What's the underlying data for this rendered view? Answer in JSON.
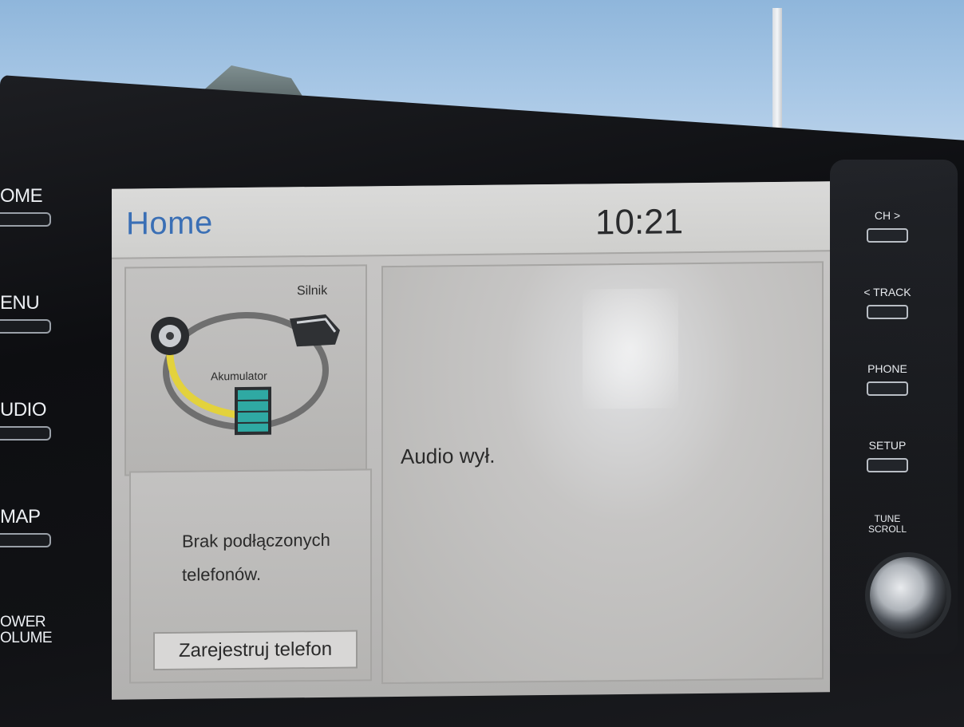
{
  "screen": {
    "title": "Home",
    "clock": "10:21"
  },
  "energy_monitor": {
    "engine_label": "Silnik",
    "battery_label": "Akumulator"
  },
  "phone_tile": {
    "message_line1": "Brak podłączonych",
    "message_line2": "telefonów.",
    "register_button": "Zarejestruj telefon"
  },
  "audio_tile": {
    "status": "Audio wył."
  },
  "left_buttons": [
    {
      "label": "OME"
    },
    {
      "label": "ENU"
    },
    {
      "label": "UDIO"
    },
    {
      "label": "MAP"
    },
    {
      "label_line1": "OWER",
      "label_line2": "OLUME"
    }
  ],
  "right_buttons": [
    {
      "label": "CH >"
    },
    {
      "label": "< TRACK"
    },
    {
      "label": "PHONE"
    },
    {
      "label": "SETUP"
    },
    {
      "label_line1": "TUNE",
      "label_line2": "SCROLL"
    }
  ],
  "colors": {
    "title_blue": "#3a6fb5",
    "battery_cells": "#2fa9a3",
    "energy_flow": "#e3d23c"
  }
}
